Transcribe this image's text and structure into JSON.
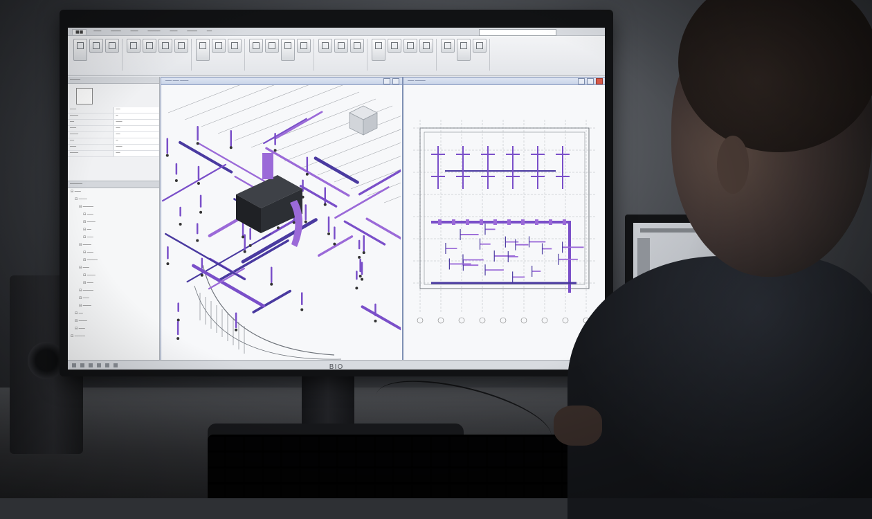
{
  "colors": {
    "duct_purple": "#7a4fc9",
    "duct_violet": "#9b6ad8",
    "duct_dark": "#4a3aa0",
    "model_line": "#6f747b",
    "ribbon": "#eceef1",
    "view_frame": "#7e8fb3",
    "close_button": "#d65a4a"
  },
  "scene": {
    "monitor_brand": "BIO",
    "icons": [
      "speaker-icon",
      "viewcube-icon",
      "close-icon",
      "minimize-icon",
      "maximize-icon"
    ]
  }
}
